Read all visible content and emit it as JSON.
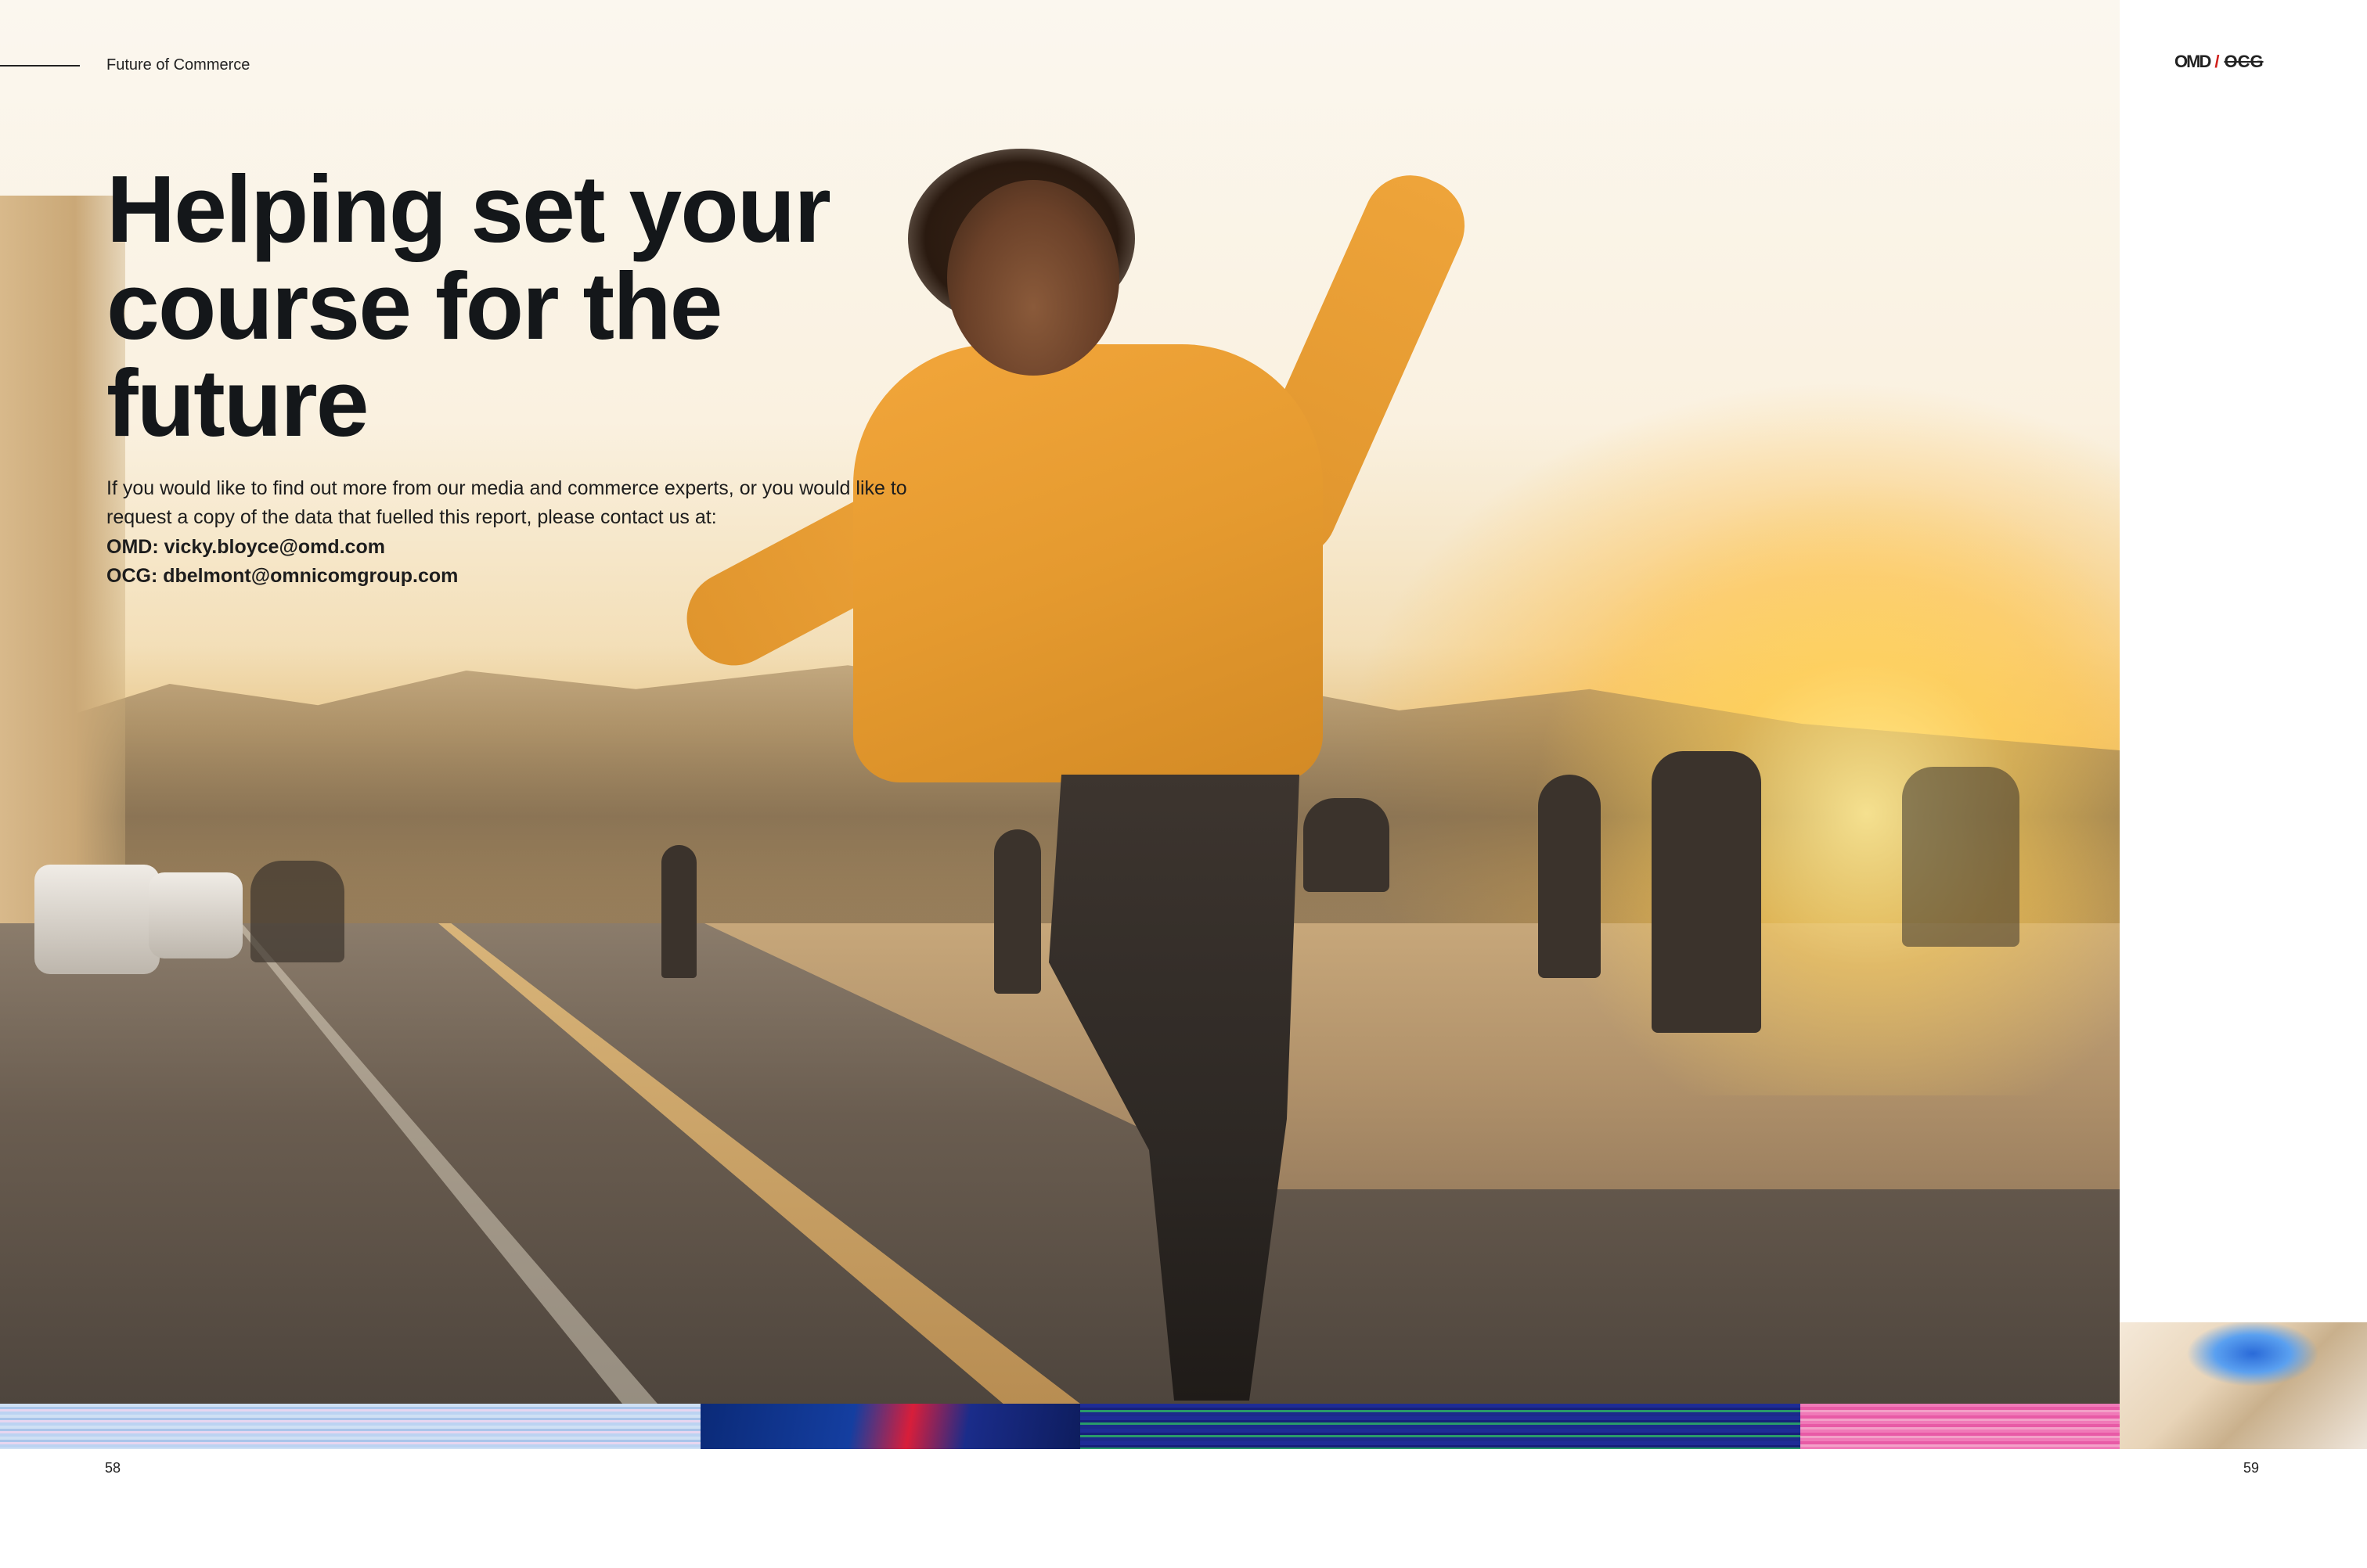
{
  "header": {
    "running_head": "Future of Commerce",
    "logo_omd": "OMD",
    "logo_slash": "/",
    "logo_ocg": "OCG"
  },
  "main": {
    "headline": "Helping set your course for the future",
    "body": "If you would like to find out more from our media and commerce experts, or you would like to request a copy of the data that fuelled this report, please contact us at:",
    "contacts": [
      {
        "label": "OMD: vicky.bloyce@omd.com"
      },
      {
        "label": "OCG: dbelmont@omnicomgroup.com"
      }
    ]
  },
  "footer": {
    "page_left": "58",
    "page_right": "59"
  },
  "colors": {
    "headline": "#14171a",
    "hoodie": "#e59a2f",
    "glitch_blue": "#1e2c96",
    "glitch_pink": "#f07ab8"
  }
}
